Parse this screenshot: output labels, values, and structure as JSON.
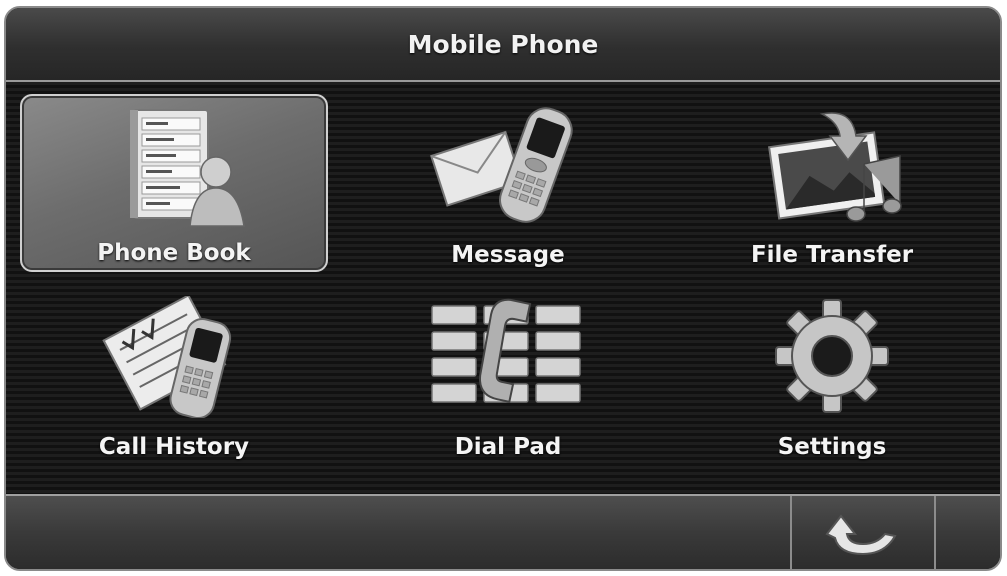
{
  "header": {
    "title": "Mobile Phone"
  },
  "menu": {
    "items": [
      {
        "label": "Phone Book",
        "icon": "phone-book-icon",
        "selected": true
      },
      {
        "label": "Message",
        "icon": "message-icon",
        "selected": false
      },
      {
        "label": "File Transfer",
        "icon": "file-transfer-icon",
        "selected": false
      },
      {
        "label": "Call History",
        "icon": "call-history-icon",
        "selected": false
      },
      {
        "label": "Dial Pad",
        "icon": "dial-pad-icon",
        "selected": false
      },
      {
        "label": "Settings",
        "icon": "settings-icon",
        "selected": false
      }
    ]
  },
  "footer": {
    "back_icon": "back-arrow-icon"
  }
}
